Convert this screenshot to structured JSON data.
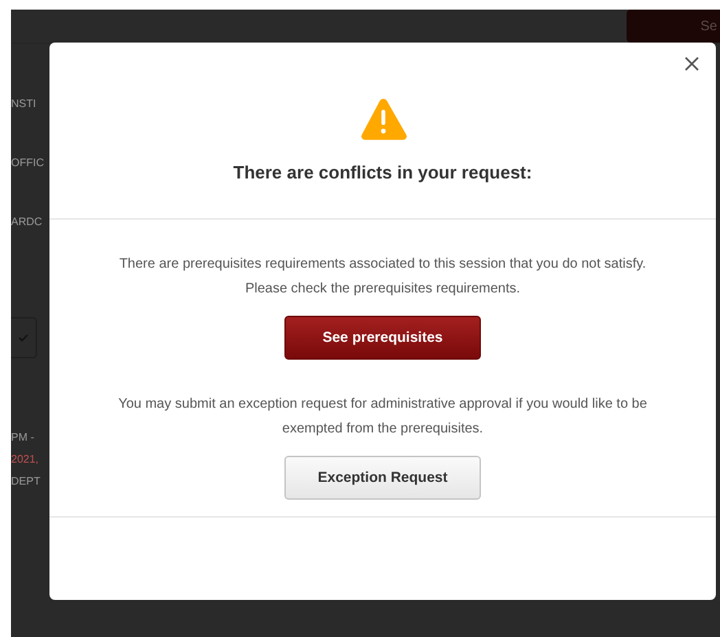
{
  "background_page": {
    "top_button": "Se",
    "left_fragments": [
      {
        "text": "NSTI",
        "kind": "text"
      },
      {
        "text": "OFFIC",
        "kind": "text"
      },
      {
        "text": "ARDC",
        "kind": "text"
      },
      {
        "kind": "checkbox"
      },
      {
        "text": "PM -",
        "kind": "text"
      },
      {
        "text": "2021,",
        "kind": "date"
      },
      {
        "text": "DEPT",
        "kind": "text"
      }
    ]
  },
  "dialog": {
    "title": "There are conflicts in your request:",
    "sections": [
      {
        "message": "There are prerequisites requirements associated to this session that you do not satisfy. Please check the prerequisites requirements.",
        "button": "See prerequisites",
        "kind": "primary"
      },
      {
        "message": "You may submit an exception request for administrative approval if you would like to be exempted from the prerequisites.",
        "button": "Exception Request",
        "kind": "secondary"
      }
    ]
  }
}
